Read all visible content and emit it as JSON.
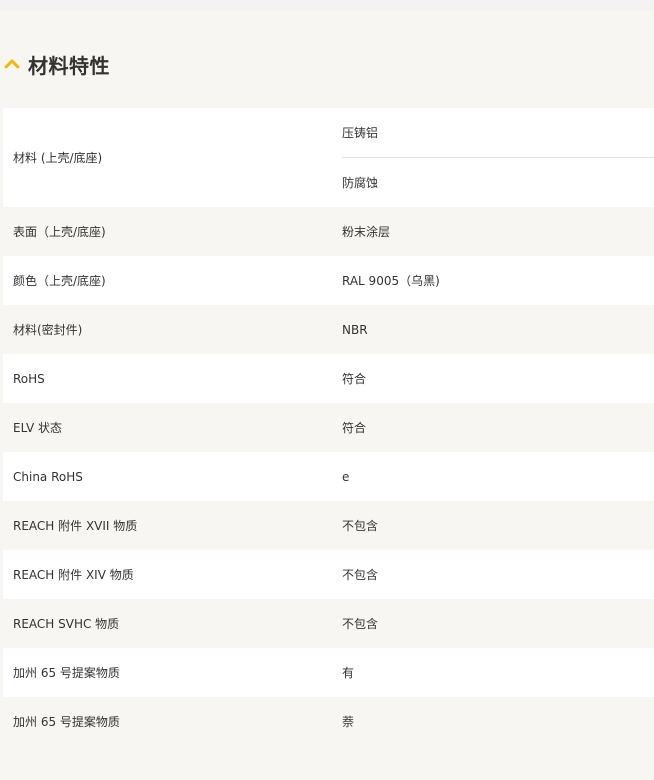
{
  "section": {
    "title": "材料特性",
    "icon": "chevron-up-icon",
    "accent_color": "#f5b800"
  },
  "rows": [
    {
      "label": "材料 (上壳/底座)",
      "values": [
        "压铸铝",
        "防腐蚀"
      ]
    },
    {
      "label": "表面（上壳/底座)",
      "value": "粉末涂层"
    },
    {
      "label": "颜色（上壳/底座)",
      "value": "RAL 9005（乌黑)"
    },
    {
      "label": "材料(密封件)",
      "value": "NBR"
    },
    {
      "label": "RoHS",
      "value": "符合"
    },
    {
      "label": "ELV 状态",
      "value": "符合"
    },
    {
      "label": "China RoHS",
      "value": "e"
    },
    {
      "label": "REACH 附件 XVII 物质",
      "value": "不包含"
    },
    {
      "label": "REACH 附件 XIV 物质",
      "value": "不包含"
    },
    {
      "label": "REACH SVHC 物质",
      "value": "不包含"
    },
    {
      "label": "加州 65 号提案物质",
      "value": "有"
    },
    {
      "label": "加州 65 号提案物质",
      "value": "萘"
    }
  ]
}
